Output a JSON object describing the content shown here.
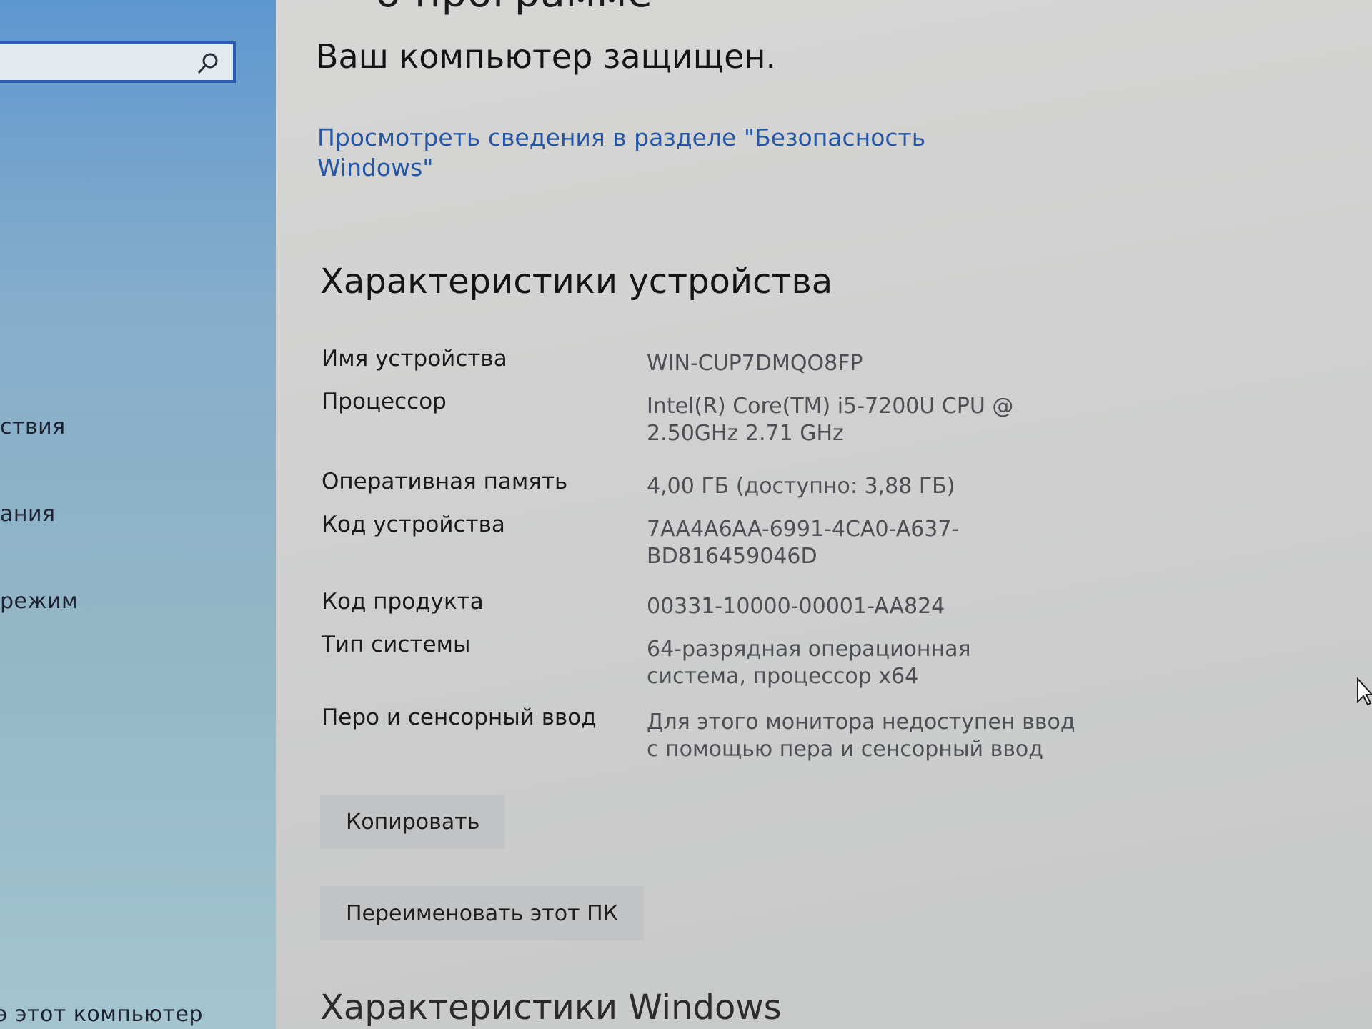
{
  "sidebar": {
    "items": [
      {
        "label": "ствия"
      },
      {
        "label": "ания"
      },
      {
        "label": "режим"
      },
      {
        "label": "э этот компьютер"
      }
    ]
  },
  "main": {
    "top_cut_text": "о программе",
    "protected_text": "Ваш компьютер защищен.",
    "security_link": "Просмотреть сведения в разделе \"Безопасность Windows\"",
    "device_specs_title": "Характеристики устройства",
    "specs": [
      {
        "label": "Имя устройства",
        "value": "WIN-CUP7DMQO8FP"
      },
      {
        "label": "Процессор",
        "value": "Intel(R) Core(TM) i5-7200U CPU @ 2.50GHz 2.71 GHz"
      },
      {
        "label": "Оперативная память",
        "value": "4,00 ГБ (доступно: 3,88 ГБ)"
      },
      {
        "label": "Код устройства",
        "value": "7AA4A6AA-6991-4CA0-A637-BD816459046D"
      },
      {
        "label": "Код продукта",
        "value": "00331-10000-00001-AA824"
      },
      {
        "label": "Тип системы",
        "value": "64-разрядная операционная система, процессор x64"
      },
      {
        "label": "Перо и сенсорный ввод",
        "value": "Для этого монитора недоступен ввод с помощью пера и сенсорный ввод"
      }
    ],
    "copy_button": "Копировать",
    "rename_button": "Переименовать этот ПК",
    "windows_specs_title": "Характеристики Windows"
  }
}
